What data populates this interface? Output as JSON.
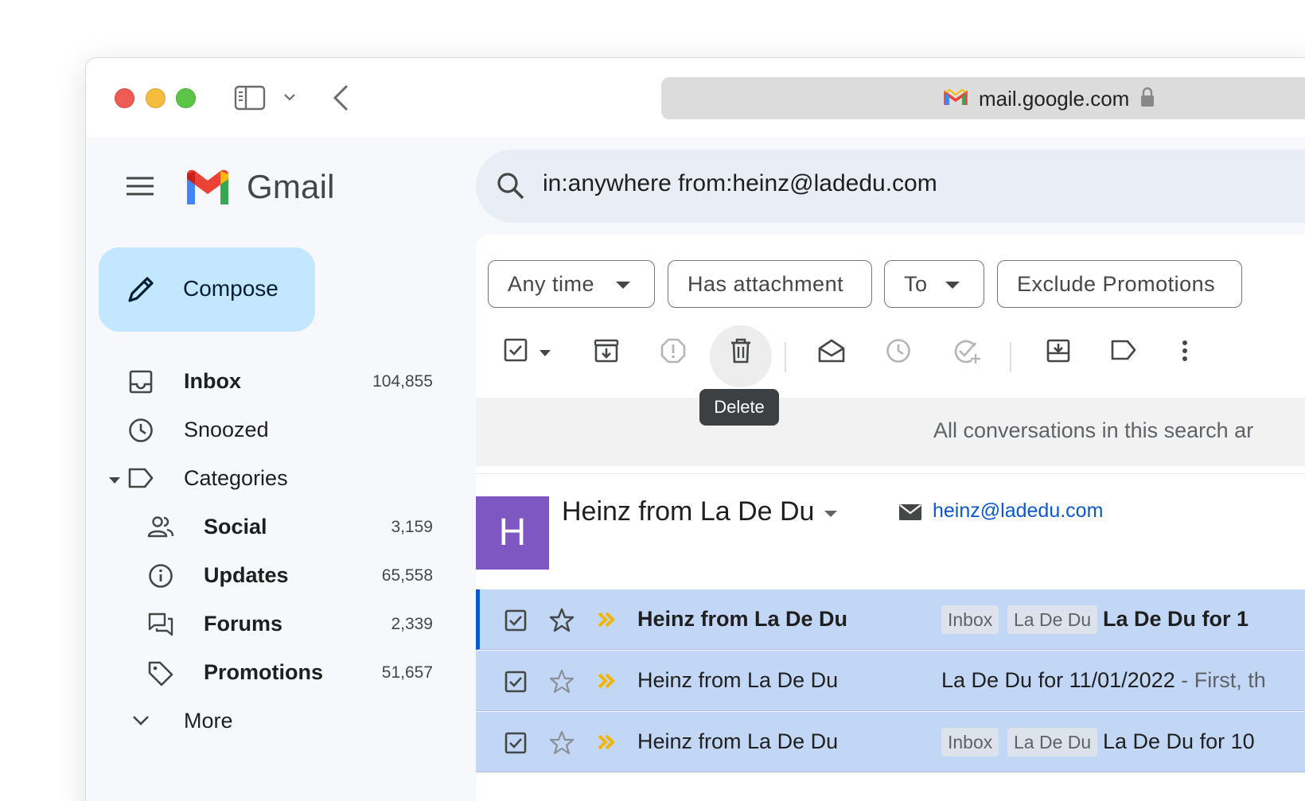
{
  "browser": {
    "url": "mail.google.com"
  },
  "app": {
    "name": "Gmail"
  },
  "compose_label": "Compose",
  "sidebar": {
    "items": [
      {
        "label": "Inbox",
        "count": "104,855",
        "bold": true
      },
      {
        "label": "Snoozed",
        "count": "",
        "bold": false
      },
      {
        "label": "Categories",
        "count": "",
        "bold": false
      },
      {
        "label": "Social",
        "count": "3,159",
        "bold": true
      },
      {
        "label": "Updates",
        "count": "65,558",
        "bold": true
      },
      {
        "label": "Forums",
        "count": "2,339",
        "bold": true
      },
      {
        "label": "Promotions",
        "count": "51,657",
        "bold": true
      },
      {
        "label": "More",
        "count": "",
        "bold": false
      }
    ]
  },
  "search": {
    "query": "in:anywhere from:heinz@ladedu.com"
  },
  "filters": {
    "any_time": "Any time",
    "has_attachment": "Has attachment",
    "to": "To",
    "exclude_promotions": "Exclude Promotions"
  },
  "toolbar": {
    "tooltip": "Delete"
  },
  "notice": {
    "text": "All conversations in this search ar"
  },
  "sender_card": {
    "initial": "H",
    "name": "Heinz from La De Du",
    "email": "heinz@ladedu.com"
  },
  "rows": [
    {
      "sender": "Heinz from La De Du",
      "tags": [
        "Inbox",
        "La De Du"
      ],
      "subject": "La De Du for 1",
      "snippet": "",
      "unread": true
    },
    {
      "sender": "Heinz from La De Du",
      "tags": [],
      "subject": "La De Du for 11/01/2022",
      "snippet": " - First, th",
      "unread": false
    },
    {
      "sender": "Heinz from La De Du",
      "tags": [
        "Inbox",
        "La De Du"
      ],
      "subject": "La De Du for 10",
      "snippet": "",
      "unread": false
    }
  ],
  "colors": {
    "compose_bg": "#c2e7ff",
    "search_bg": "#e9eef6",
    "selected_row": "#c2d7f5",
    "avatar": "#7e57c2",
    "link": "#0b57d0"
  }
}
